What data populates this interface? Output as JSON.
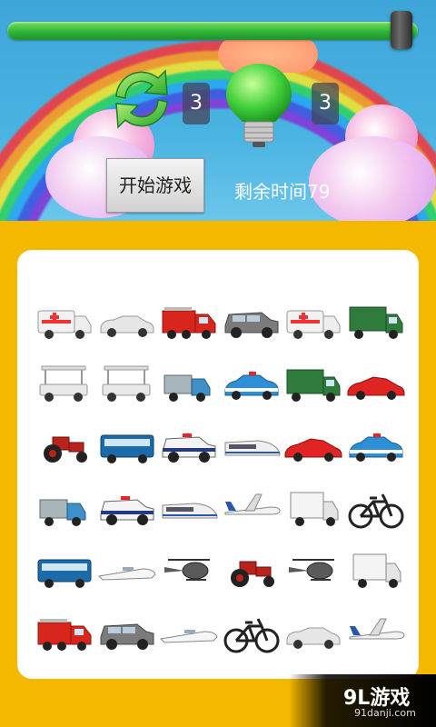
{
  "game": {
    "progress": 0.985,
    "hint_count": "3",
    "bulb_count": "3",
    "start_label": "开始游戏",
    "timer_text": "剩余时间79"
  },
  "board": {
    "rows": [
      [
        "ambulance",
        "convertible",
        "fire-truck",
        "suv",
        "ambulance",
        "cargo-truck"
      ],
      [
        "golf-cart",
        "golf-cart",
        "sweeper-truck",
        "police-car",
        "cargo-truck",
        "sports-car"
      ],
      [
        "tractor",
        "bus",
        "police-suv",
        "bullet-train",
        "sports-car",
        "police-car"
      ],
      [
        "sweeper-truck",
        "police-suv",
        "bullet-train",
        "airplane",
        "box-truck",
        "bicycle"
      ],
      [
        "bus",
        "speedboat",
        "helicopter",
        "tractor",
        "helicopter",
        "box-truck"
      ],
      [
        "fire-truck",
        "suv",
        "speedboat",
        "bicycle",
        "convertible",
        "airplane"
      ]
    ]
  },
  "brand": {
    "main": "9L游戏",
    "sub": "91danji.com"
  },
  "colors": {
    "board_bg": "#ffffff",
    "frame": "#f5b800",
    "slider": "#2fb53a"
  }
}
